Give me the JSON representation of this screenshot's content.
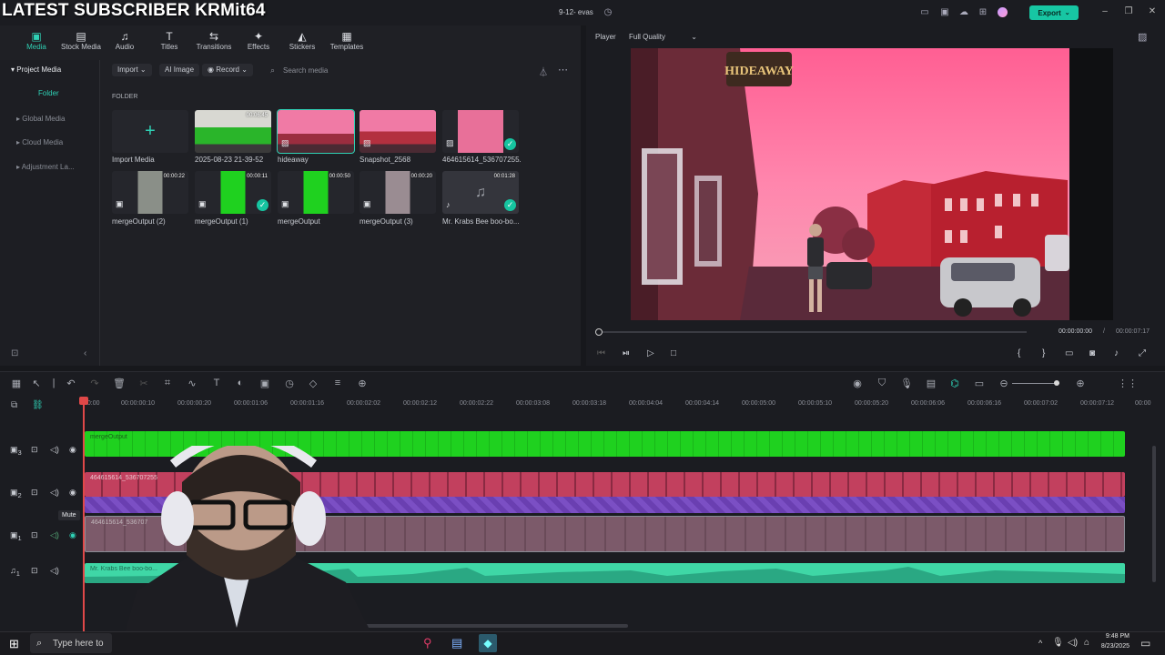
{
  "overlay": {
    "banner": "LATEST SUBSCRIBER KRMit64"
  },
  "titlebar": {
    "project": "9-12- evas",
    "export_label": "Export"
  },
  "media_tabs": [
    {
      "label": "Media",
      "icon": "media-icon"
    },
    {
      "label": "Stock Media",
      "icon": "stock-media-icon"
    },
    {
      "label": "Audio",
      "icon": "audio-icon"
    },
    {
      "label": "Titles",
      "icon": "titles-icon"
    },
    {
      "label": "Transitions",
      "icon": "transitions-icon"
    },
    {
      "label": "Effects",
      "icon": "effects-icon"
    },
    {
      "label": "Stickers",
      "icon": "stickers-icon"
    },
    {
      "label": "Templates",
      "icon": "templates-icon"
    }
  ],
  "sidebar": {
    "project_media": "Project Media",
    "folder": "Folder",
    "global_media": "Global Media",
    "cloud_media": "Cloud Media",
    "adjustment": "Adjustment La..."
  },
  "media_toolbar": {
    "import": "Import",
    "ai_image": "AI Image",
    "record": "Record",
    "search_placeholder": "Search media"
  },
  "folder_label": "FOLDER",
  "media_items": [
    {
      "label": "Import Media"
    },
    {
      "label": "2025-08-23 21-39-52",
      "duration": "00:06:45"
    },
    {
      "label": "hideaway"
    },
    {
      "label": "Snapshot_2568"
    },
    {
      "label": "464615614_536707255..."
    },
    {
      "label": "mergeOutput (2)",
      "duration": "00:00:22"
    },
    {
      "label": "mergeOutput (1)",
      "duration": "00:00:11"
    },
    {
      "label": "mergeOutput",
      "duration": "00:00:50"
    },
    {
      "label": "mergeOutput (3)",
      "duration": "00:00:20"
    },
    {
      "label": "Mr. Krabs Bee boo-bo...",
      "duration": "00:01:28"
    }
  ],
  "player": {
    "label": "Player",
    "quality": "Full Quality",
    "sign_text": "HIDEAWAY",
    "time_current": "00:00:00:00",
    "time_total": "00:00:07:17",
    "progress": 0
  },
  "timeline": {
    "ticks": [
      "00:00",
      "00:00:00:10",
      "00:00:00:20",
      "00:00:01:06",
      "00:00:01:16",
      "00:00:02:02",
      "00:00:02:12",
      "00:00:02:22",
      "00:00:03:08",
      "00:00:03:18",
      "00:00:04:04",
      "00:00:04:14",
      "00:00:05:00",
      "00:00:05:10",
      "00:00:05:20",
      "00:00:06:06",
      "00:00:06:16",
      "00:00:07:02",
      "00:00:07:12",
      "00:00"
    ],
    "tooltip": "Mute",
    "tracks": [
      {
        "number": "3"
      },
      {
        "number": "2"
      },
      {
        "number": "1"
      },
      {
        "number": "1"
      }
    ],
    "clip_names": {
      "green": "mergeOutput",
      "pink": "464615614_536707255",
      "dim": "464615614_536707",
      "audio": "Mr. Krabs Bee boo-bo..."
    }
  },
  "taskbar": {
    "search": "Type here to",
    "time": "9:48 PM",
    "date": "8/23/2025"
  }
}
